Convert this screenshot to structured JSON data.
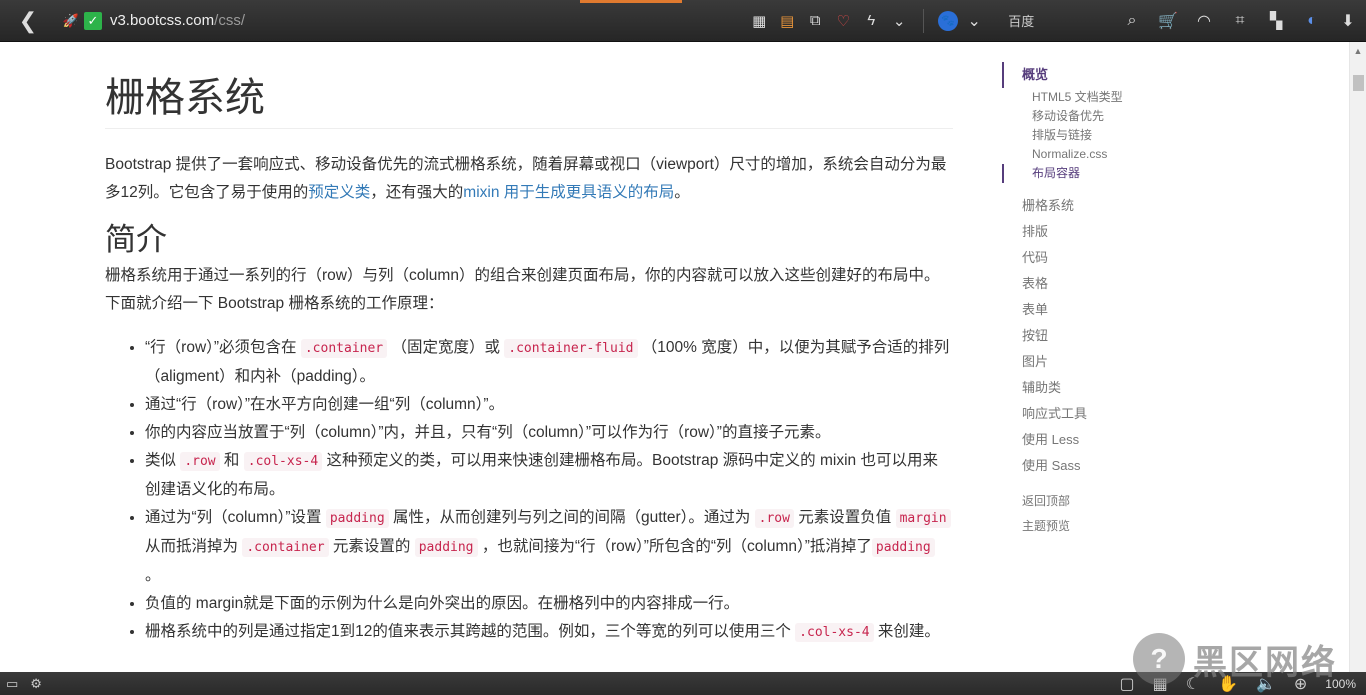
{
  "browser": {
    "back_label": "❮",
    "url_host": "v3.bootcss.com",
    "url_path": "/css/",
    "search_engine": "百度",
    "icons": [
      "qr-code-icon",
      "reader-icon",
      "screenshot-icon",
      "heart-icon",
      "lightning-icon",
      "chevron-down-icon",
      "baidu-paw-icon",
      "chevron-down-icon",
      "search-icon",
      "cart-icon",
      "wifi-icon",
      "crop-icon",
      "grid-icon",
      "sync-icon",
      "download-icon"
    ]
  },
  "main": {
    "title": "栅格系统",
    "lead": {
      "before": "Bootstrap 提供了一套响应式、移动设备优先的流式栅格系统，随着屏幕或视口（viewport）尺寸的增加，系统会自动分为最多12列。它包含了易于使用的",
      "link1": "预定义类",
      "middle": "，还有强大的",
      "link2": "mixin 用于生成更具语义的布局",
      "after": "。"
    },
    "section_heading": "简介",
    "intro": "栅格系统用于通过一系列的行（row）与列（column）的组合来创建页面布局，你的内容就可以放入这些创建好的布局中。下面就介绍一下 Bootstrap 栅格系统的工作原理：",
    "bullets": {
      "b1": {
        "t1": "“行（row）”必须包含在 ",
        "c1": ".container",
        "t2": " （固定宽度）或 ",
        "c2": ".container-fluid",
        "t3": " （100% 宽度）中，以便为其赋予合适的排列（aligment）和内补（padding）。"
      },
      "b2": {
        "t1": "通过“行（row）”在水平方向创建一组“列（column）”。"
      },
      "b3": {
        "t1": "你的内容应当放置于“列（column）”内，并且，只有“列（column）”可以作为行（row）”的直接子元素。"
      },
      "b4": {
        "t1": "类似 ",
        "c1": ".row",
        "t2": " 和 ",
        "c2": ".col-xs-4",
        "t3": " 这种预定义的类，可以用来快速创建栅格布局。Bootstrap 源码中定义的 mixin 也可以用来创建语义化的布局。"
      },
      "b5": {
        "t1": "通过为“列（column）”设置 ",
        "c1": "padding",
        "t2": " 属性，从而创建列与列之间的间隔（gutter）。通过为 ",
        "c2": ".row",
        "t3": " 元素设置负值 ",
        "c3": "margin",
        "t4": " 从而抵消掉为 ",
        "c4": ".container",
        "t5": " 元素设置的 ",
        "c5": "padding",
        "t6": " ，也就间接为“行（row）”所包含的“列（column）”抵消掉了",
        "c6": "padding",
        "t7": " 。"
      },
      "b6": {
        "t1": "负值的 margin就是下面的示例为什么是向外突出的原因。在栅格列中的内容排成一行。"
      },
      "b7": {
        "t1": "栅格系统中的列是通过指定1到12的值来表示其跨越的范围。例如，三个等宽的列可以使用三个 ",
        "c1": ".col-xs-4",
        "t2": " 来创建。"
      }
    }
  },
  "sidenav": {
    "active": "概览",
    "sub": [
      "HTML5 文档类型",
      "移动设备优先",
      "排版与链接",
      "Normalize.css",
      "布局容器"
    ],
    "items": [
      "栅格系统",
      "排版",
      "代码",
      "表格",
      "表单",
      "按钮",
      "图片",
      "辅助类",
      "响应式工具",
      "使用 Less",
      "使用 Sass"
    ],
    "footer": [
      "返回顶部",
      "主题预览"
    ]
  },
  "statusbar": {
    "zoom": "100%"
  },
  "watermark": {
    "text": "黑区网络"
  },
  "colors": {
    "link": "#337ab7",
    "code_text": "#c7254e",
    "code_bg": "#f9f2f4",
    "nav_active": "#563d7c",
    "tab_indicator": "#e07a2f"
  }
}
